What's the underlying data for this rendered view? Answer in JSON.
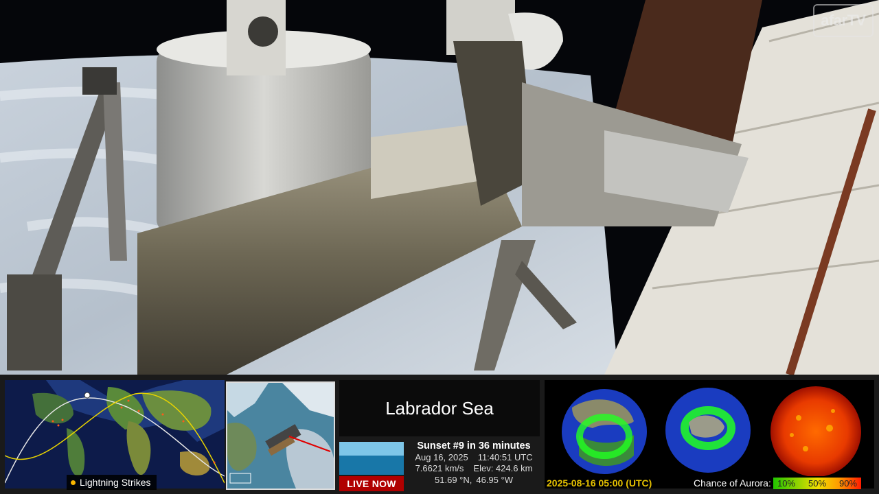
{
  "watermark": "afarTV",
  "lightning_label": "Lightning Strikes",
  "location": "Labrador Sea",
  "live_label": "LIVE NOW",
  "sunset": "Sunset #9 in 36 minutes",
  "date": "Aug 16, 2025",
  "time_utc": "11:40:51 UTC",
  "speed": "7.6621 km/s",
  "elevation": "Elev: 424.6 km",
  "latitude": "51.69 °N,",
  "longitude": "46.95 °W",
  "aurora_date": "2025-08-16 05:00 (UTC)",
  "aurora_chance_label": "Chance of Aurora:",
  "aurora_scale": [
    "10%",
    "50%",
    "90%"
  ],
  "colors": {
    "live_red": "#b00000",
    "aurora_date_yellow": "#e6c200",
    "lightning_dot": "#f7b500",
    "panel_bg": "#1a1a1a"
  }
}
